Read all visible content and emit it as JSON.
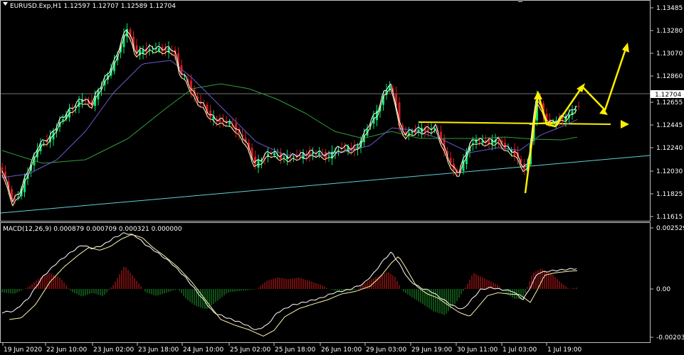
{
  "window": {
    "main_title": "EURUSD.Exp,H1  1.12597 1.12707 1.12589 1.12704",
    "sub_title": "MACD(12,26,9) 0.000879 0.000709 0.000321 0.000000"
  },
  "colors": {
    "background": "#000000",
    "frame": "#c0c0c0",
    "bull_candle": "#00e676",
    "bear_candle": "#d81b1b",
    "ma_fast": "#ffffff",
    "ma_mid": "#fff4b0",
    "ma_slow": "#6a5acd",
    "ma_long": "#2e9e3a",
    "trendline": "#5fd0d8",
    "annotation": "#ffee00",
    "macd_pos": "#d81b1b",
    "macd_neg": "#1c9e2a",
    "macd_line": "#ffffff",
    "signal_line": "#fff4b0"
  },
  "price_axis": {
    "ticks": [
      "1.13485",
      "1.13280",
      "1.13070",
      "1.12860",
      "1.12655",
      "1.12445",
      "1.12240",
      "1.12030",
      "1.11825",
      "1.11615"
    ],
    "current_price": "1.12704"
  },
  "macd_axis": {
    "ticks": [
      "0.002529",
      "0.00",
      "-0.00203"
    ]
  },
  "time_axis": {
    "labels": [
      "19 Jun 2020",
      "22 Jun 10:00",
      "23 Jun 02:00",
      "23 Jun 18:00",
      "24 Jun 10:00",
      "25 Jun 02:00",
      "25 Jun 18:00",
      "26 Jun 10:00",
      "29 Jun 03:00",
      "29 Jun 19:00",
      "30 Jun 11:00",
      "1 Jul 03:00",
      "1 Jul 19:00"
    ]
  },
  "icons": [
    "collapse-arrow-icon"
  ]
}
